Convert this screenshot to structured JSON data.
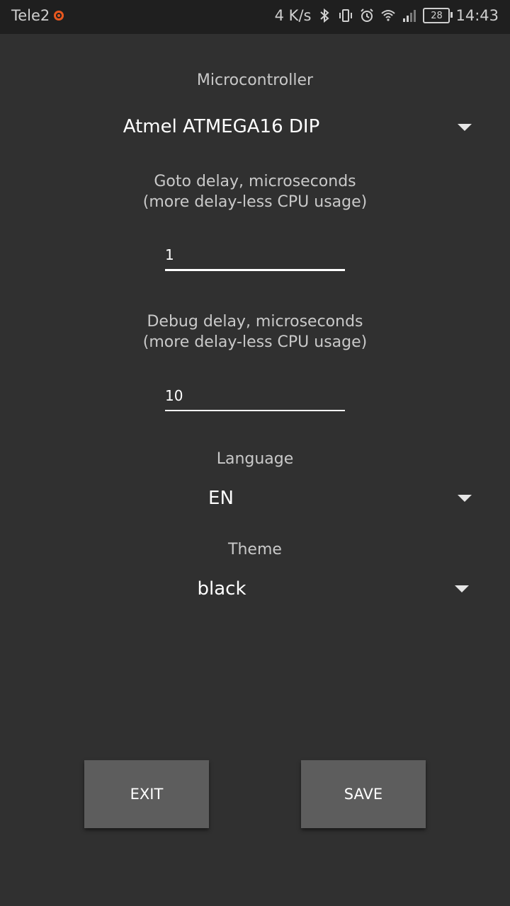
{
  "status_bar": {
    "carrier": "Tele2",
    "net_speed": "4 K/s",
    "battery": "28",
    "time": "14:43",
    "icons": [
      "bluetooth-icon",
      "vibrate-icon",
      "alarm-icon",
      "wifi-icon",
      "signal-icon",
      "battery-icon"
    ]
  },
  "settings": {
    "microcontroller_label": "Microcontroller",
    "microcontroller_value": "Atmel ATMEGA16 DIP",
    "goto_delay_label_line1": "Goto delay, microseconds",
    "goto_delay_label_line2": "(more delay-less CPU usage)",
    "goto_delay_value": "1",
    "debug_delay_label_line1": "Debug delay, microseconds",
    "debug_delay_label_line2": "(more delay-less CPU usage)",
    "debug_delay_value": "10",
    "language_label": "Language",
    "language_value": "EN",
    "theme_label": "Theme",
    "theme_value": "black"
  },
  "buttons": {
    "exit_label": "EXIT",
    "save_label": "SAVE"
  },
  "colors": {
    "background": "#303030",
    "status_bar": "#1f1f1f",
    "button": "#5d5d5d"
  }
}
